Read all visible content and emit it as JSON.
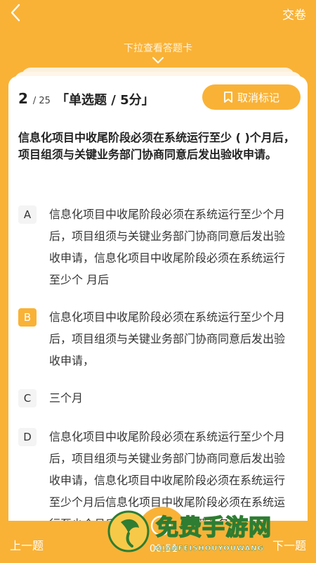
{
  "header": {
    "submit_label": "交卷",
    "pull_hint": "下拉查看答题卡"
  },
  "question": {
    "current": "2",
    "total": "/ 25",
    "type": "「单选题 / 5分」",
    "unmark_label": "取消标记",
    "stem": "信息化项目中收尾阶段必须在系统运行至少 ( )个月后，项目组须与关键业务部门协商同意后发出验收申请。",
    "options": [
      {
        "letter": "A",
        "text": "信息化项目中收尾阶段必须在系统运行至少个月后，项目组须与关键业务部门协商同意后发出验收申请，信息化项目中收尾阶段必须在系统运行至少个 月后",
        "selected": false
      },
      {
        "letter": "B",
        "text": "信息化项目中收尾阶段必须在系统运行至少个月后，项目组须与关键业务部门协商同意后发出验收申请，",
        "selected": true
      },
      {
        "letter": "C",
        "text": "三个月",
        "selected": false
      },
      {
        "letter": "D",
        "text": "信息化项目中收尾阶段必须在系统运行至少个月后，项目组须与关键业务部门协商同意后发出验收申请，信息化项目中收尾阶段必须在系统运行至少个月后信息化项目中收尾阶段必须在系统运行至少个月后，项目组须与关键业务部",
        "selected": false
      }
    ]
  },
  "footer": {
    "prev_label": "上一题",
    "next_label": "下一题",
    "timer": "00:51"
  },
  "watermark": {
    "title": "免费手游网",
    "subtitle": "MIANFEISHOUYOUWANG"
  },
  "colors": {
    "accent": "#F9B236",
    "watermark_green": "#2E7D32"
  },
  "icons": {
    "back": "chevron-left-icon",
    "pull": "chevron-down-icon",
    "unmark": "bookmark-icon",
    "timer": "clock-icon"
  }
}
